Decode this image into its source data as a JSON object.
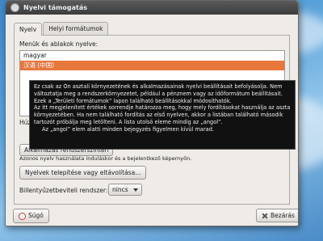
{
  "window": {
    "title": "Nyelvi támogatás"
  },
  "tabs": [
    {
      "label": "Nyelv"
    },
    {
      "label": "Helyi formátumok"
    }
  ],
  "language": {
    "label": "Menük és ablakok nyelve:",
    "items": [
      "magyar",
      "汉语 (中国)"
    ],
    "selected_index": 1
  },
  "partial": {
    "left_fragment": "Húzz",
    "apply_button": "Alkalmazás rendszerszinten",
    "apply_note": "Azonos nyelv használata induláskor és a bejelentkező képernyőn."
  },
  "install_button": "Nyelvek telepítése vagy eltávolítása...",
  "input_method": {
    "label": "Billentyűzetbeviteli rendszer:",
    "value": "nincs"
  },
  "tooltip_lines": [
    "Ez csak az Ön asztali környezetének és alkalmazásainak nyelvi beállításait befolyásolja. Nem",
    "változtatja meg a rendszerkörnyezetet, például a pénznem vagy az időformátum beállításait.",
    "Ezek a „Területi formátumok” lapon található beállításokkal módosíthatók.",
    "Az itt megjelenített értékek sorrendje határozza meg, hogy mely fordításokat használja az asztali",
    "környezetében. Ha nem található fordítás az első nyelven, akkor a listában található második",
    "tartozót próbálja meg letölteni. A lista utolsó eleme mindig az „angol”.",
    "Az „angol” elem alatti minden bejegyzés figyelmen kívül marad."
  ],
  "buttons": {
    "help": "Súgó",
    "close": "Bezárás"
  },
  "colors": {
    "selection": "#e8773c",
    "tooltip_bg": "#111111"
  }
}
